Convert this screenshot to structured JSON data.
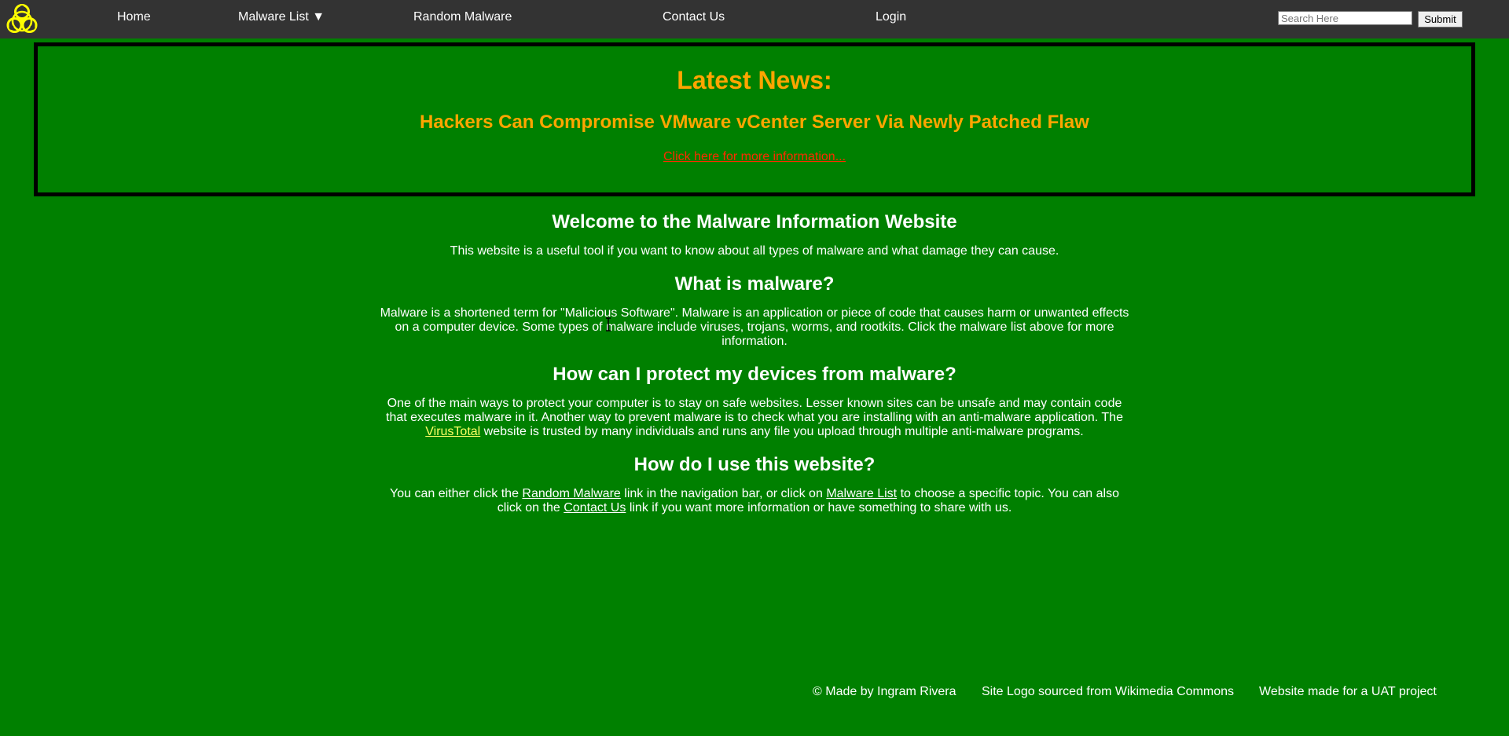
{
  "nav": {
    "logo": "biohazard-icon",
    "home": "Home",
    "malware_list": "Malware List ▼",
    "random_malware": "Random Malware",
    "contact_us": "Contact Us",
    "login": "Login",
    "search_placeholder": "Search Here",
    "submit": "Submit"
  },
  "news": {
    "title": "Latest News:",
    "headline": "Hackers Can Compromise VMware vCenter Server Via Newly Patched Flaw",
    "link": "Click here for more information..."
  },
  "sections": {
    "welcome_heading": "Welcome to the Malware Information Website",
    "welcome_text": "This website is a useful tool if you want to know about all types of malware and what damage they can cause.",
    "what_heading": "What is malware?",
    "what_text": "Malware is a shortened term for \"Malicious Software\". Malware is an application or piece of code that causes harm or unwanted effects on a computer device. Some types of malware include viruses, trojans, worms, and rootkits. Click the malware list above for more information.",
    "protect_heading": "How can I protect my devices from malware?",
    "protect_text_1": "One of the main ways to protect your computer is to stay on safe websites. Lesser known sites can be unsafe and may contain code that executes malware in it. Another way to prevent malware is to check what you are installing with an anti-malware application. The",
    "protect_link": "VirusTotal",
    "protect_text_2": "website is trusted by many individuals and runs any file you upload through multiple anti-malware programs.",
    "use_heading": "How do I use this website?",
    "use_text_1": "You can either click the",
    "use_link_random": "Random Malware",
    "use_text_2": "link in the navigation bar, or click on",
    "use_link_list": "Malware List",
    "use_text_3": "to choose a specific topic. You can also click on the",
    "use_link_contact": "Contact Us",
    "use_text_4": "link if you want more information or have something to share with us."
  },
  "footer": {
    "made_by": "© Made by Ingram Rivera",
    "logo_source": "Site Logo sourced from Wikimedia Commons",
    "project": "Website made for a UAT project"
  },
  "colors": {
    "page_background": "#008000",
    "navbar": "#333333",
    "news_heading": "#ffa500",
    "news_link": "#ff2a00",
    "logo": "#ffff00"
  }
}
